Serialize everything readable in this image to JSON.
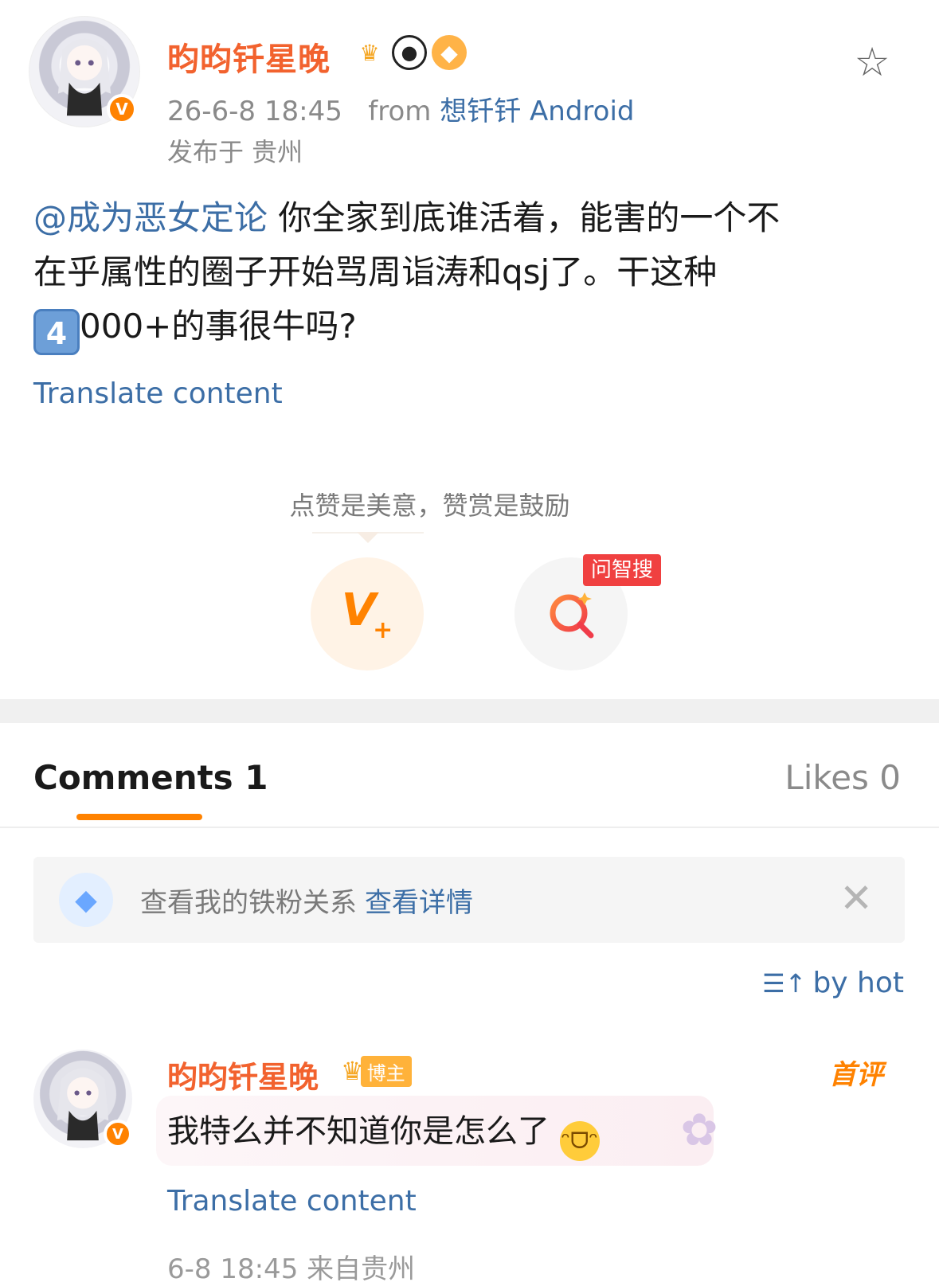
{
  "post": {
    "username": "昀昀钎星晚",
    "meta_time": "26-6-8 18:45",
    "meta_from": "from",
    "meta_source": "想钎钎 Android",
    "location": "发布于 贵州",
    "mention": "@成为恶女定论",
    "body_line1": " 你全家到底谁活着，能害的一个不",
    "body_line2": "在乎属性的圈子开始骂周诣涛和qsj了。干这种",
    "keycap": "4",
    "body_line3": "000+的事很牛吗?",
    "translate": "Translate content"
  },
  "reward": {
    "tip": "点赞是美意，赞赏是鼓励",
    "search_tag": "问智搜"
  },
  "tabs": {
    "comments": "Comments 1",
    "likes": "Likes 0"
  },
  "fan_banner": {
    "text": "查看我的铁粉关系",
    "link": "查看详情"
  },
  "sort": {
    "label": "by hot"
  },
  "comment": {
    "username": "昀昀钎星晚",
    "badge": "博主",
    "first": "首评",
    "text": "我特么并不知道你是怎么了",
    "translate": "Translate content",
    "meta": "6-8 18:45 来自贵州"
  },
  "colors": {
    "accent": "#ff8200",
    "name": "#f2622e",
    "link": "#3c6ea6"
  }
}
